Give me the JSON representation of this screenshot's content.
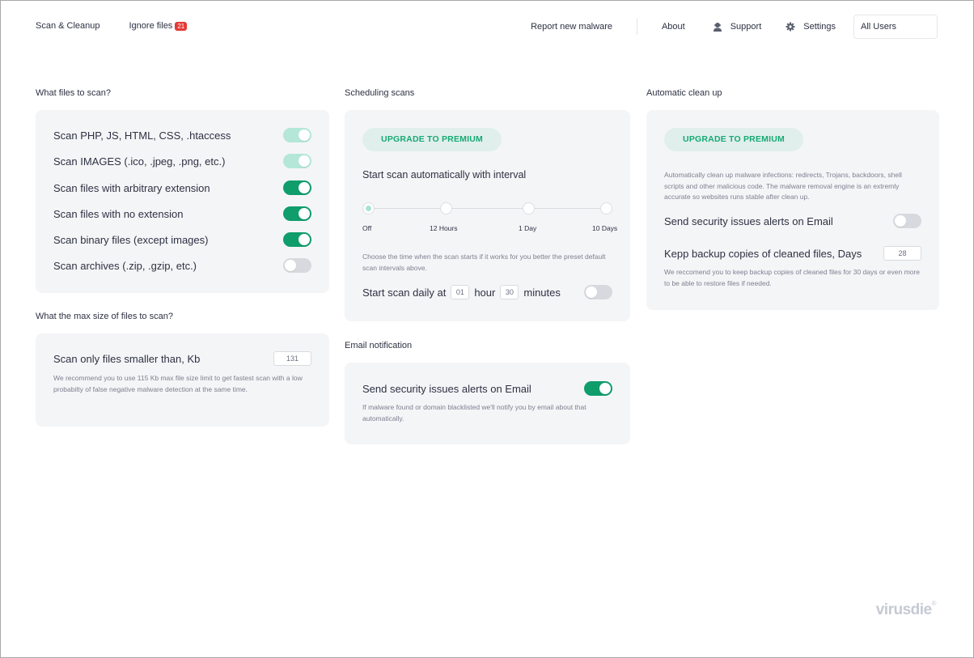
{
  "nav": {
    "left": [
      {
        "label": "Scan & Cleanup"
      },
      {
        "label": "Ignore files",
        "badge": "21"
      }
    ],
    "report_label": "Report new malware",
    "about_label": "About",
    "support_label": "Support",
    "support_icon": "user-headset-icon",
    "settings_label": "Settings",
    "settings_icon": "gear-icon",
    "user_select_value": "All Users"
  },
  "files_section": {
    "title": "What files to scan?",
    "options": [
      {
        "label": "Scan PHP, JS, HTML, CSS, .htaccess",
        "state": "on",
        "disabled": true
      },
      {
        "label": "Scan IMAGES (.ico, .jpeg, .png, etc.)",
        "state": "on",
        "disabled": true
      },
      {
        "label": "Scan files with arbitrary extension",
        "state": "on",
        "disabled": false
      },
      {
        "label": "Scan files with no extension",
        "state": "on",
        "disabled": false
      },
      {
        "label": "Scan binary files (except images)",
        "state": "on",
        "disabled": false
      },
      {
        "label": "Scan archives (.zip, .gzip, etc.)",
        "state": "off",
        "disabled": false
      }
    ]
  },
  "size_section": {
    "title": "What the max size of files to scan?",
    "label": "Scan only files smaller than, Kb",
    "value": "131",
    "help": "We recommend you to use 115 Kb max file size limit to get fastest scan with a low probabilty of false negative malware detection at the same time."
  },
  "scheduling": {
    "title": "Scheduling scans",
    "premium_label": "UPGRADE TO PREMIUM",
    "interval_heading": "Start scan automatically with interval",
    "interval_options": [
      "Off",
      "12 Hours",
      "1 Day",
      "10 Days"
    ],
    "interval_selected": "Off",
    "help": "Choose the time when the scan starts if it works for you better the preset default scan intervals above.",
    "daily_prefix": "Start scan daily at",
    "hour_value": "01",
    "hour_label": "hour",
    "minute_value": "30",
    "minute_label": "minutes",
    "daily_toggle": "off"
  },
  "email": {
    "title": "Email notification",
    "label": "Send security issues alerts on Email",
    "toggle": "on",
    "help": "If malware found or domain blacklisted we'll notify you by email about that automatically."
  },
  "cleanup": {
    "title": "Automatic clean up",
    "premium_label": "UPGRADE TO PREMIUM",
    "description": "Automatically clean up malware infections: redirects, Trojans, backdoors, shell scripts and other malicious code. The malware removal engine is an extremly accurate so websites runs stable after clean up.",
    "email_label": "Send security issues alerts on Email",
    "email_toggle": "off",
    "backup_label": "Kepp backup copies of cleaned files, Days",
    "backup_value": "28",
    "backup_help": "We reccomend you to keep backup copies of cleaned files for 30 days or even more to be able to restore files if needed."
  },
  "brand": {
    "logo": "virusdie",
    "reg_mark": "®"
  },
  "colors": {
    "accent": "#0f9d6c",
    "accent_disabled": "#b4e7d7",
    "premium_text": "#16a974",
    "badge": "#e53935"
  }
}
